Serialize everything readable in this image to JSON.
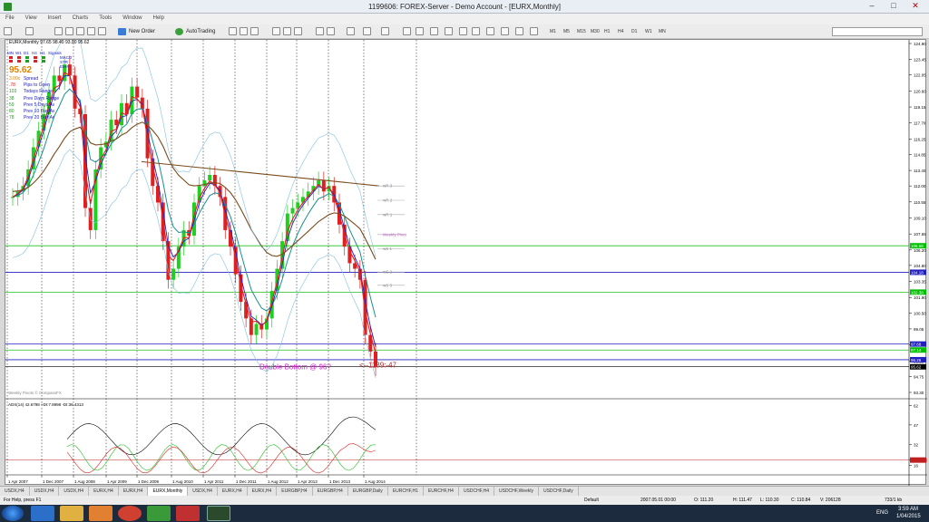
{
  "window": {
    "title": "1199606: FOREX-Server - Demo Account - [EURX,Monthly]"
  },
  "menu": [
    "File",
    "View",
    "Insert",
    "Charts",
    "Tools",
    "Window",
    "Help"
  ],
  "toolbar": {
    "new_order": "New Order",
    "autotrading": "AutoTrading",
    "timeframes": [
      "M1",
      "M5",
      "M15",
      "M30",
      "H1",
      "H4",
      "D1",
      "W1",
      "MN"
    ]
  },
  "chart": {
    "header": "EURX,Monthly  97.65 98.40 93.90 95.62",
    "price_axis": [
      "124.90",
      "123.45",
      "122.05",
      "120.60",
      "119.15",
      "117.70",
      "116.25",
      "114.85",
      "113.40",
      "112.00",
      "110.55",
      "109.10",
      "107.65",
      "106.20",
      "104.80",
      "103.35",
      "101.90",
      "100.50",
      "99.05",
      "97.60",
      "96.15",
      "94.75",
      "93.30"
    ],
    "price_tags": [
      {
        "text": "106.58",
        "color": "#00c000"
      },
      {
        "text": "104.18",
        "color": "#2020c0"
      },
      {
        "text": "102.38",
        "color": "#00c000"
      },
      {
        "text": "97.68",
        "color": "#2020c0"
      },
      {
        "text": "97.14",
        "color": "#00c000"
      },
      {
        "text": "96.26",
        "color": "#2020c0"
      },
      {
        "text": "95.62",
        "color": "#000000"
      }
    ],
    "date_axis": [
      "1 Apr 2007",
      "1 Dec 2007",
      "1 Aug 2008",
      "1 Apr 2009",
      "1 Dec 2009",
      "1 Aug 2010",
      "1 Apr 2011",
      "1 Dec 2011",
      "1 Aug 2012",
      "1 Apr 2013",
      "1 Dec 2013",
      "1 Aug 2014"
    ],
    "pivot_labels": [
      "wR 3",
      "wR 2",
      "wR 1",
      "Weekly Pivot",
      "wS 1",
      "wS 2",
      "wS 3"
    ],
    "annotation": "Double Bottom @ 96?",
    "countdown": "<--1139:-47",
    "watermark": "Weekly Pivots © CompassFX",
    "adx_header": "ADX(14) 42.6798 +DI:7.9998 -DI:36.4313",
    "adx_axis": [
      "62",
      "47",
      "32",
      "20.0000",
      "16"
    ]
  },
  "info_panel": {
    "tf_labels": [
      "MN",
      "W1",
      "D1",
      "H4",
      "H1",
      "Signals"
    ],
    "legend": [
      "MACD",
      "STR",
      "EMA"
    ],
    "price": "95.62",
    "rows": [
      {
        "v": "3.00c",
        "l": "Spread"
      },
      {
        "v": ".78",
        "l": "Pips to Open"
      },
      {
        "v": "103",
        "l": "Todays Range"
      },
      {
        "v": "38",
        "l": "Prev Days Range"
      },
      {
        "v": "59",
        "l": "Prev 5 Days Av"
      },
      {
        "v": "80",
        "l": "Prev 10 Day Av"
      },
      {
        "v": "78",
        "l": "Prev 20 Day Av"
      }
    ]
  },
  "tabs": [
    "USDX,H4",
    "USDX,H4",
    "USDX,H4",
    "EURX,H4",
    "EURX,H4",
    "EURX,Monthly",
    "USDX,H4",
    "EURX,H4",
    "EURX,H4",
    "EURGBP,H4",
    "EURGBP,H4",
    "EURGBP,Daily",
    "EURCHF,H1",
    "EURCHF,H4",
    "USDCHF,H4",
    "USDCHF,Weekly",
    "USDCHF,Daily"
  ],
  "active_tab": 5,
  "status": {
    "help": "For Help, press F1",
    "profile": "Default",
    "datetime": "2007.05.01 00:00",
    "o": "O: 111.20",
    "h": "H: 111.47",
    "l": "L: 110.30",
    "c": "C: 110.84",
    "v": "V: 206128",
    "traffic": "733/1 kb"
  },
  "taskbar": {
    "lang": "ENG",
    "time": "3:59 AM",
    "date": "1/04/2015"
  }
}
